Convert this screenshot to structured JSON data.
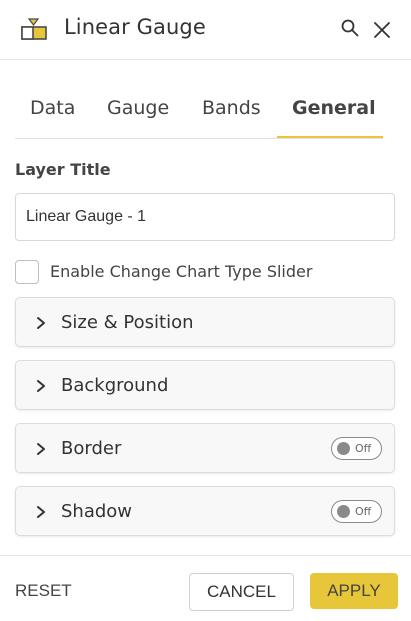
{
  "header": {
    "title": "Linear Gauge",
    "icon": "linear-gauge-icon",
    "accent_color": "#e8c63a"
  },
  "tabs": [
    {
      "label": "Data",
      "active": false
    },
    {
      "label": "Gauge",
      "active": false
    },
    {
      "label": "Bands",
      "active": false
    },
    {
      "label": "General",
      "active": true
    }
  ],
  "layer_title": {
    "label": "Layer Title",
    "value": "Linear Gauge - 1"
  },
  "change_chart_type": {
    "label": "Enable Change Chart Type Slider",
    "checked": false
  },
  "panels": [
    {
      "title": "Size & Position"
    },
    {
      "title": "Background"
    },
    {
      "title": "Border",
      "toggle": "Off"
    },
    {
      "title": "Shadow",
      "toggle": "Off"
    }
  ],
  "footer": {
    "reset_label": "RESET",
    "cancel_label": "CANCEL",
    "apply_label": "APPLY"
  }
}
